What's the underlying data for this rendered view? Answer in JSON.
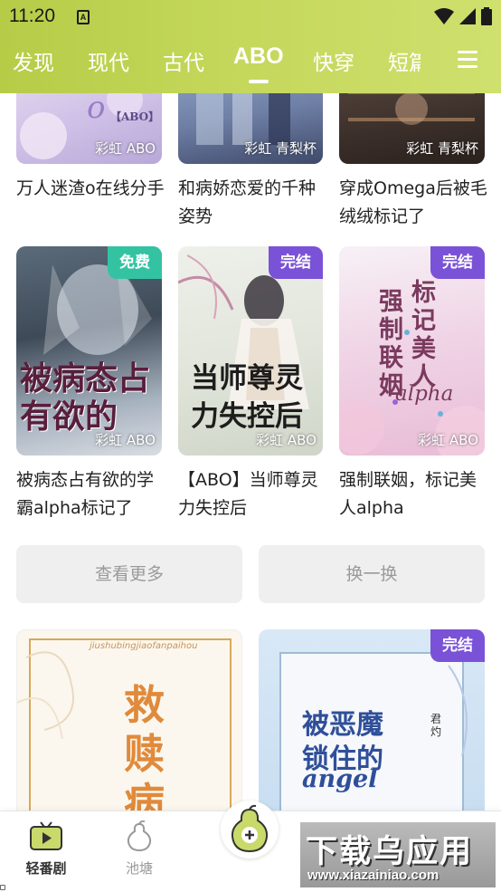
{
  "status_bar": {
    "time": "11:20",
    "notification_icon": "A"
  },
  "tabs": [
    {
      "label": "发现",
      "active": false
    },
    {
      "label": "现代",
      "active": false
    },
    {
      "label": "古代",
      "active": false
    },
    {
      "label": "ABO",
      "active": true
    },
    {
      "label": "快穿",
      "active": false
    },
    {
      "label": "短篇",
      "active": false
    }
  ],
  "menu_icon": "hamburger-icon",
  "books_row1": [
    {
      "title": "万人迷渣o在线分手",
      "author": "彩虹 ABO",
      "cover_text": "【ABO】"
    },
    {
      "title": "和病娇恋爱的千种姿势",
      "author": "彩虹 青梨杯"
    },
    {
      "title": "穿成Omega后被毛绒绒标记了",
      "author": "彩虹 青梨杯"
    }
  ],
  "books_row2": [
    {
      "title": "被病态占有欲的学霸alpha标记了",
      "author": "彩虹 ABO",
      "badge": "免费",
      "cover_text": "被病态占有欲的"
    },
    {
      "title": "【ABO】当师尊灵力失控后",
      "author": "彩虹 ABO",
      "badge": "完结",
      "cover_text": "当师尊灵力失控后"
    },
    {
      "title": "强制联姻，标记美人alpha",
      "author": "彩虹 ABO",
      "badge": "完结",
      "cover_text_a": "强制联姻",
      "cover_text_b": "标记美人",
      "cover_text_c": "alpha"
    }
  ],
  "actions": {
    "more": "查看更多",
    "refresh": "换一换"
  },
  "books_row3": [
    {
      "cover_text": "救赎病反派",
      "cover_subtitle": "jiushubingjiaofanpaihou"
    },
    {
      "cover_text_a": "被恶魔",
      "cover_text_b": "锁住的",
      "cover_text_c": "angel",
      "cover_author": "君灼",
      "badge": "完结"
    }
  ],
  "bottom_nav": [
    {
      "label": "轻番剧",
      "icon": "tv-icon",
      "active": true
    },
    {
      "label": "池塘",
      "icon": "pear-outline-icon",
      "active": false
    }
  ],
  "center_button_icon": "pear-add-icon",
  "watermark": {
    "line1": "下载乌应用",
    "line2": "www.xiazainiao.com"
  },
  "colors": {
    "header_green": "#c4d75a",
    "badge_free": "#34c3a2",
    "badge_done": "#7a52d8",
    "nav_active": "#333333",
    "nav_inactive": "#999999"
  }
}
